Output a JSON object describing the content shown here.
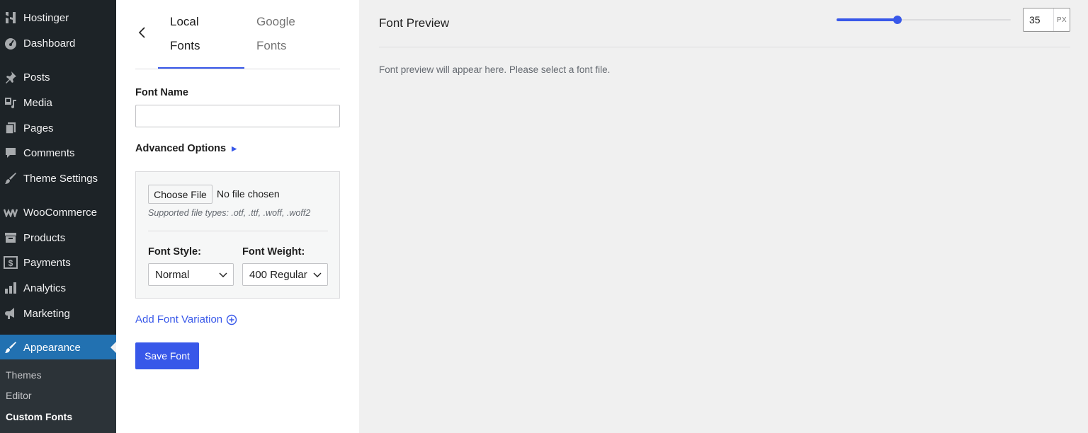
{
  "sidebar": {
    "items": [
      {
        "label": "Hostinger",
        "icon": "hostinger-logo-icon"
      },
      {
        "label": "Dashboard",
        "icon": "dashboard-gauge-icon"
      },
      {
        "label": "Posts",
        "icon": "pushpin-icon"
      },
      {
        "label": "Media",
        "icon": "media-icon"
      },
      {
        "label": "Pages",
        "icon": "pages-icon"
      },
      {
        "label": "Comments",
        "icon": "comment-bubble-icon"
      },
      {
        "label": "Theme Settings",
        "icon": "brush-icon"
      },
      {
        "label": "WooCommerce",
        "icon": "woocommerce-icon"
      },
      {
        "label": "Products",
        "icon": "archive-box-icon"
      },
      {
        "label": "Payments",
        "icon": "dollar-icon"
      },
      {
        "label": "Analytics",
        "icon": "bar-chart-icon"
      },
      {
        "label": "Marketing",
        "icon": "megaphone-icon"
      },
      {
        "label": "Appearance",
        "icon": "paintbrush-icon",
        "active": true
      }
    ],
    "submenu": [
      {
        "label": "Themes"
      },
      {
        "label": "Editor"
      },
      {
        "label": "Custom Fonts",
        "current": true
      }
    ],
    "colors": {
      "background": "#1d2327",
      "active": "#2271b1"
    }
  },
  "panel": {
    "tabs": [
      {
        "label_line1": "Local",
        "label_line2": "Fonts",
        "active": true
      },
      {
        "label_line1": "Google",
        "label_line2": "Fonts",
        "active": false
      }
    ],
    "font_name_label": "Font Name",
    "font_name_value": "",
    "advanced_options_label": "Advanced Options",
    "choose_file_label": "Choose File",
    "no_file_text": "No file chosen",
    "supported_types": "Supported file types: .otf, .ttf, .woff, .woff2",
    "font_style_label": "Font Style:",
    "font_style_value": "Normal",
    "font_weight_label": "Font Weight:",
    "font_weight_value": "400 Regular",
    "add_variation_label": "Add Font Variation",
    "save_label": "Save Font",
    "accent_color": "#3858e9"
  },
  "preview": {
    "title": "Font Preview",
    "size_value": "35",
    "size_unit": "PX",
    "slider_fraction": 0.35,
    "message": "Font preview will appear here. Please select a font file."
  }
}
